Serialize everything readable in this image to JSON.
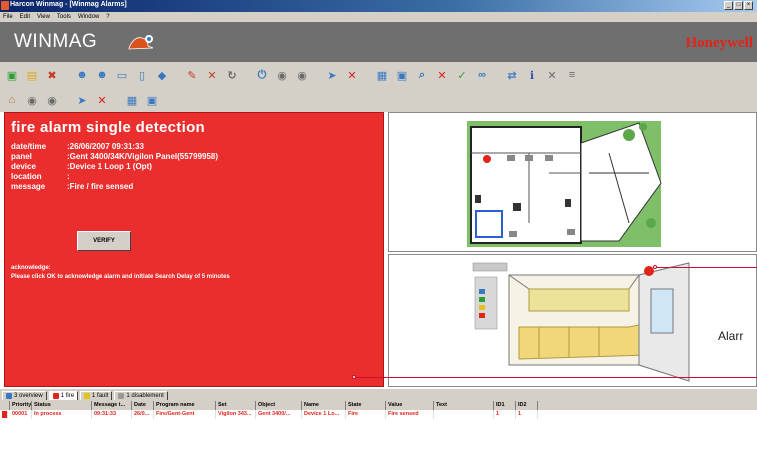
{
  "window": {
    "title": "Harcon Winmag - [Winmag Alarms]",
    "controls": [
      "_",
      "□",
      "×"
    ]
  },
  "menu": [
    "File",
    "Edit",
    "View",
    "Tools",
    "Window",
    "?"
  ],
  "brand": {
    "product": "WINMAG",
    "vendor": "Honeywell",
    "vendor_color": "#e2231a"
  },
  "toolbar_icons_row1": [
    {
      "name": "green-square-icon",
      "color": "#2e9e3a",
      "glyph": "▣"
    },
    {
      "name": "folder-icon",
      "color": "#e3a91c",
      "glyph": "▤"
    },
    {
      "name": "tools-icon",
      "color": "#c23b22",
      "glyph": "✖"
    },
    {
      "name": "user-icon",
      "color": "#3a78c2",
      "glyph": "☻"
    },
    {
      "name": "users-icon",
      "color": "#3a78c2",
      "glyph": "☻"
    },
    {
      "name": "monitor-icon",
      "color": "#3a78c2",
      "glyph": "▭"
    },
    {
      "name": "window-icon",
      "color": "#3a78c2",
      "glyph": "▯"
    },
    {
      "name": "tag-icon",
      "color": "#3a78c2",
      "glyph": "◆"
    },
    {
      "name": "edit-icon",
      "color": "#c23b22",
      "glyph": "✎"
    },
    {
      "name": "tools-cross-icon",
      "color": "#c23b22",
      "glyph": "✕"
    },
    {
      "name": "refresh-icon",
      "color": "#6a6a6a",
      "glyph": "↻"
    },
    {
      "name": "power-icon",
      "color": "#3a78c2",
      "glyph": "⏻"
    },
    {
      "name": "circle-gray-icon",
      "color": "#6a6a6a",
      "glyph": "◉"
    },
    {
      "name": "circle-gray2-icon",
      "color": "#6a6a6a",
      "glyph": "◉"
    },
    {
      "name": "send-icon",
      "color": "#3a78c2",
      "glyph": "➤"
    },
    {
      "name": "cancel-icon",
      "color": "#d62020",
      "glyph": "✕"
    },
    {
      "name": "grid-icon",
      "color": "#3a78c2",
      "glyph": "▦"
    },
    {
      "name": "window2-icon",
      "color": "#3a78c2",
      "glyph": "▣"
    },
    {
      "name": "search-icon",
      "color": "#3a78c2",
      "glyph": "⌕"
    },
    {
      "name": "delete-icon",
      "color": "#d62020",
      "glyph": "✕"
    },
    {
      "name": "check-icon",
      "color": "#2e9e3a",
      "glyph": "✓"
    },
    {
      "name": "link-icon",
      "color": "#3a78c2",
      "glyph": "∞"
    },
    {
      "name": "arrow-icon",
      "color": "#3a78c2",
      "glyph": "⇄"
    },
    {
      "name": "info-icon",
      "color": "#2a4fb5",
      "glyph": "ℹ"
    },
    {
      "name": "close-x-icon",
      "color": "#6a6a6a",
      "glyph": "✕"
    },
    {
      "name": "list-icon",
      "color": "#6a6a6a",
      "glyph": "≡"
    }
  ],
  "toolbar_icons_row2": [
    {
      "name": "building-icon",
      "color": "#c2682b",
      "glyph": "⌂"
    },
    {
      "name": "circle-a-icon",
      "color": "#6a6a6a",
      "glyph": "◉"
    },
    {
      "name": "circle-b-icon",
      "color": "#6a6a6a",
      "glyph": "◉"
    },
    {
      "name": "forward-icon",
      "color": "#3a78c2",
      "glyph": "➤"
    },
    {
      "name": "remove-icon",
      "color": "#d62020",
      "glyph": "✕"
    },
    {
      "name": "table-icon",
      "color": "#3a78c2",
      "glyph": "▦"
    },
    {
      "name": "panel-icon",
      "color": "#3a78c2",
      "glyph": "▣"
    }
  ],
  "alarm": {
    "title": "fire alarm single detection",
    "fields": [
      {
        "key": "date/time",
        "value": ":26/06/2007 09:31:33"
      },
      {
        "key": "panel",
        "value": ":Gent 3400/34K/Vigilon Panel(55799958)"
      },
      {
        "key": "device",
        "value": ":Device 1 Loop 1 (Opt)"
      },
      {
        "key": "location",
        "value": ":"
      },
      {
        "key": "message",
        "value": ":Fire / fire sensed"
      }
    ],
    "verify_label": "VERIFY",
    "ack_title": "acknowledge:",
    "ack_text": "Please click OK to acknowledge alarm and initiate Search Delay of 5 minutes",
    "bg_color": "#ea2d2d"
  },
  "callout": {
    "label": "Alarr"
  },
  "tabs": [
    {
      "label": "3 overview",
      "dot": "#3a78c2"
    },
    {
      "label": "1 fire",
      "dot": "#e2231a",
      "active": true
    },
    {
      "label": "1 fault",
      "dot": "#e3c21c"
    },
    {
      "label": "1 disablement",
      "dot": "#9a9a9a"
    }
  ],
  "list": {
    "columns": [
      "",
      "Priority",
      "Status",
      "Message t...",
      "Date",
      "Program name",
      "Set",
      "Object",
      "Name",
      "State",
      "Value",
      "Text",
      "ID1",
      "ID2"
    ],
    "rows": [
      [
        "",
        "00001",
        "In process",
        "09:31:33",
        "26/0...",
        "Fire/Gent-Gent",
        "Vigilon 343...",
        "Gent 3400/...",
        "Device 1 Lo...",
        "Fire",
        "Fire sensed",
        "",
        "1",
        "1"
      ]
    ]
  }
}
